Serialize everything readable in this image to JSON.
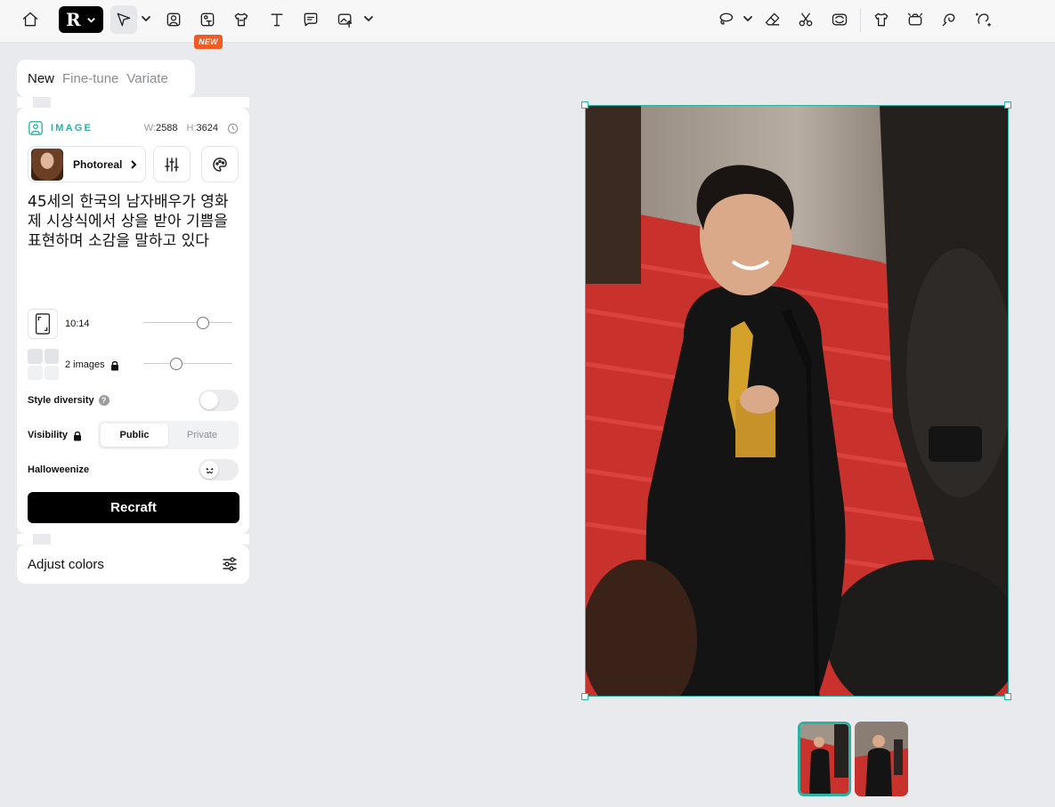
{
  "toolbar": {
    "new_badge": "NEW",
    "logo_mark": "R",
    "left_icons": [
      "home-icon",
      "select-arrow-icon",
      "image-icon",
      "text-to-image-icon",
      "mockup-shirt-icon",
      "text-icon",
      "comment-icon",
      "upload-image-icon"
    ],
    "right_icons": [
      "lasso-icon",
      "eraser-icon",
      "scissors-icon",
      "swap-image-icon",
      "shirt-icon",
      "upscale-icon",
      "vectorize-icon",
      "magic-brush-icon"
    ]
  },
  "tabs": [
    {
      "label": "New",
      "active": true
    },
    {
      "label": "Fine-tune",
      "active": false
    },
    {
      "label": "Variate",
      "active": false
    }
  ],
  "panel": {
    "section_label": "IMAGE",
    "width_label": "W:",
    "width_value": "2588",
    "height_label": "H:",
    "height_value": "3624",
    "style_name": "Photoreal",
    "prompt": "45세의 한국의 남자배우가 영화제 시상식에서 상을 받아 기쁨을 표현하며 소감을 말하고 있다",
    "aspect_ratio": "10:14",
    "image_count": "2 images",
    "style_diversity_label": "Style diversity",
    "style_diversity_help": "?",
    "visibility_label": "Visibility",
    "visibility_options": [
      "Public",
      "Private"
    ],
    "visibility_selected": "Public",
    "halloweenize_label": "Halloweenize",
    "recraft_button": "Recraft",
    "aspect_slider_value": 0.7,
    "count_slider_value": 0.35
  },
  "adjust_colors": {
    "label": "Adjust colors"
  },
  "colors": {
    "accent": "#2ab3a3",
    "badge": "#f05a24",
    "primary_button": "#000000",
    "canvas_bg": "#e9eaee"
  }
}
